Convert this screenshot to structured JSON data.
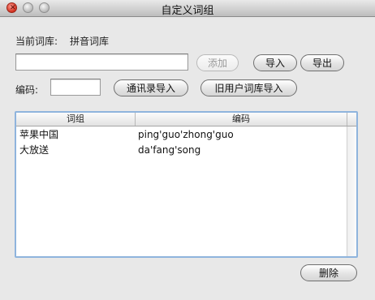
{
  "window": {
    "title": "自定义词组"
  },
  "current_lib": {
    "label": "当前词库:",
    "value": "拼音词库"
  },
  "phrase_input": {
    "value": "",
    "placeholder": ""
  },
  "buttons": {
    "add": "添加",
    "import": "导入",
    "export": "导出",
    "contacts_import": "通讯录导入",
    "old_user_import": "旧用户词库导入",
    "delete": "删除"
  },
  "code_field": {
    "label": "编码:",
    "value": ""
  },
  "table": {
    "headers": [
      "词组",
      "编码"
    ],
    "rows": [
      {
        "phrase": "苹果中国",
        "code": "ping'guo'zhong'guo"
      },
      {
        "phrase": "大放送",
        "code": "da'fang'song"
      }
    ]
  },
  "colors": {
    "selection_border": "#8fb4dd",
    "close_button": "#d2301f"
  }
}
